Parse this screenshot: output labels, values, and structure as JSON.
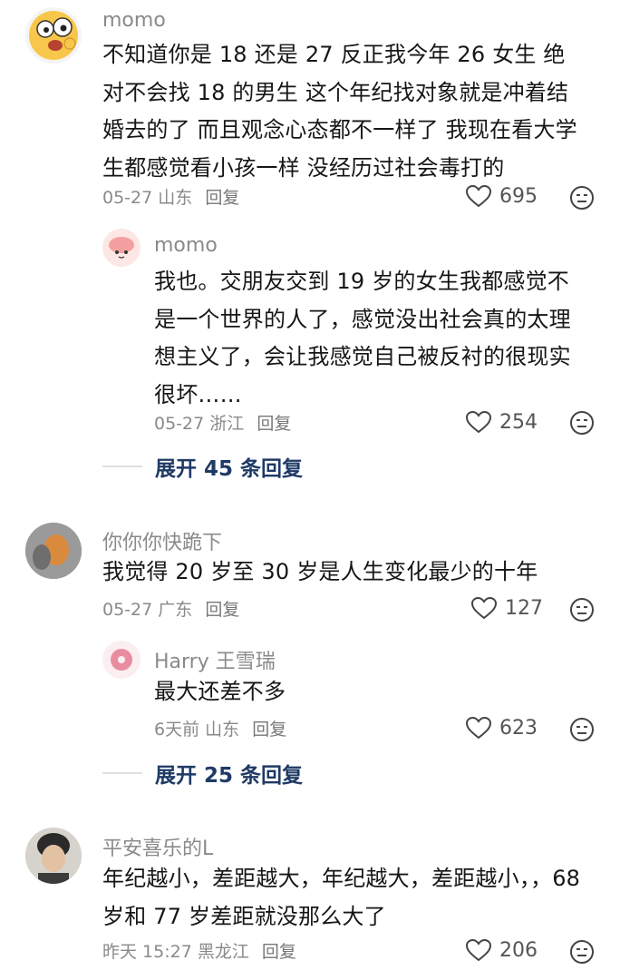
{
  "comments": [
    {
      "user": "momo",
      "text": "不知道你是 18 还是 27 反正我今年 26 女生 绝对不会找 18 的男生 这个年纪找对象就是冲着结婚去的了 而且观念心态都不一样了 我现在看大学生都感觉看小孩一样 没经历过社会毒打的",
      "date": "05-27",
      "location": "山东",
      "reply_label": "回复",
      "likes": "695",
      "replies": [
        {
          "user": "momo",
          "text": "我也。交朋友交到 19 岁的女生我都感觉不是一个世界的人了，感觉没出社会真的太理想主义了，会让我感觉自己被反衬的很现实很坏……",
          "date": "05-27",
          "location": "浙江",
          "reply_label": "回复",
          "likes": "254"
        }
      ],
      "expand_label": "展开 45 条回复"
    },
    {
      "user": "你你你快跪下",
      "text": "我觉得 20 岁至 30 岁是人生变化最少的十年",
      "date": "05-27",
      "location": "广东",
      "reply_label": "回复",
      "likes": "127",
      "replies": [
        {
          "user": "Harry 王雪瑞",
          "text": "最大还差不多",
          "date": "6天前",
          "location": "山东",
          "reply_label": "回复",
          "likes": "623"
        }
      ],
      "expand_label": "展开 25 条回复"
    },
    {
      "user": "平安喜乐的L",
      "text": "年纪越小，差距越大，年纪越大，差距越小，，68 岁和 77 岁差距就没那么大了",
      "date": "昨天 15:27",
      "location": "黑龙江",
      "reply_label": "回复",
      "likes": "206"
    }
  ],
  "icons": {
    "like": "heart-outline-icon",
    "dislike": "dislike-face-icon"
  }
}
